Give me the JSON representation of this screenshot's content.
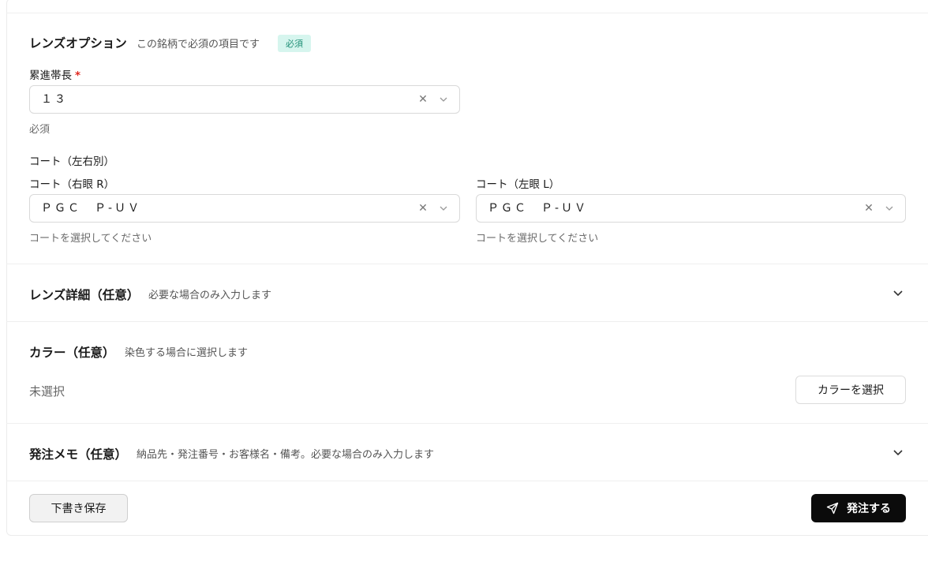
{
  "lens_options": {
    "title": "レンズオプション",
    "subtitle": "この銘柄で必須の項目です",
    "badge": "必須",
    "progressive_length": {
      "label": "累進帯長",
      "required_mark": "*",
      "value": "１３",
      "help": "必須"
    },
    "coat_group_label": "コート（左右別）",
    "coat_right": {
      "label": "コート（右眼 R）",
      "value": "ＰＧＣ　Ｐ-ＵＶ",
      "help": "コートを選択してください"
    },
    "coat_left": {
      "label": "コート（左眼 L）",
      "value": "ＰＧＣ　Ｐ-ＵＶ",
      "help": "コートを選択してください"
    }
  },
  "lens_details": {
    "title": "レンズ詳細（任意）",
    "subtitle": "必要な場合のみ入力します"
  },
  "color": {
    "title": "カラー（任意）",
    "subtitle": "染色する場合に選択します",
    "status": "未選択",
    "button": "カラーを選択"
  },
  "order_memo": {
    "title": "発注メモ（任意）",
    "subtitle": "納品先・発注番号・お客様名・備考。必要な場合のみ入力します"
  },
  "footer": {
    "draft_button": "下書き保存",
    "submit_button": "発注する"
  },
  "icons": {
    "clear": "close-icon",
    "dropdown": "chevron-down-icon",
    "send": "send-icon"
  }
}
